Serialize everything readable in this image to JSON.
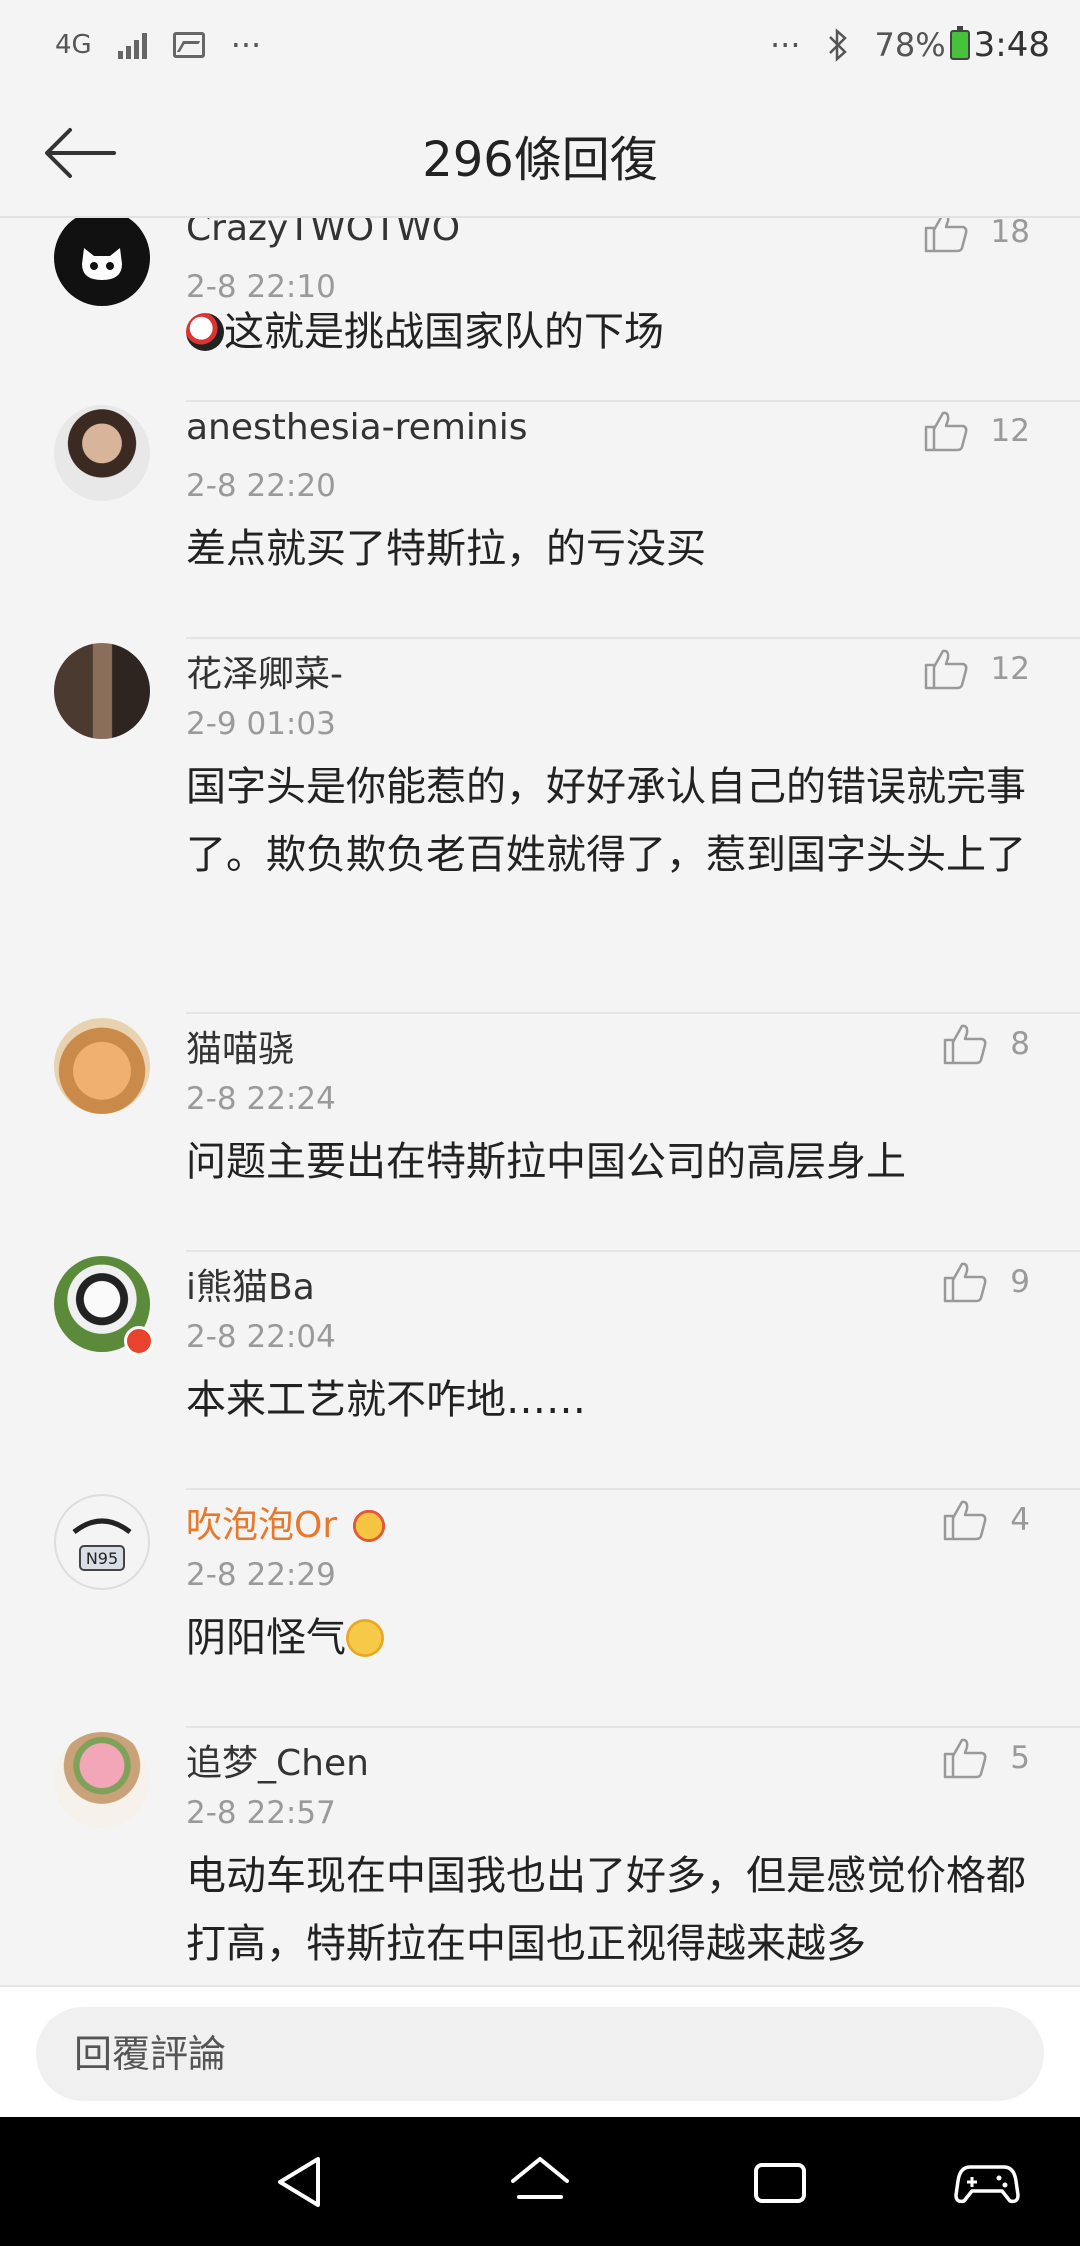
{
  "status": {
    "network": "4G",
    "battery": "78%",
    "time": "3:48",
    "more_left": "···",
    "more_right": "···",
    "icons": [
      "signal-icon",
      "image-icon",
      "bluetooth-icon",
      "battery-icon"
    ]
  },
  "header": {
    "title": "296條回復",
    "back_icon": "arrow-left-icon"
  },
  "comments": [
    {
      "user": "CrazyTWOTWO",
      "date": "2-8 22:10",
      "text": "这就是挑战国家队的下场",
      "likes": "18",
      "vip": false,
      "emoji_prefix": "panda-emoji"
    },
    {
      "user": "anesthesia-reminis",
      "date": "2-8 22:20",
      "text": "差点就买了特斯拉，的亏没买",
      "likes": "12",
      "vip": false
    },
    {
      "user": "花泽卿菜-",
      "date": "2-9 01:03",
      "text": "国字头是你能惹的，好好承认自己的错误就完事了。欺负欺负老百姓就得了，惹到国字头头上了",
      "likes": "12",
      "vip": false
    },
    {
      "user": "猫喵骁",
      "date": "2-8 22:24",
      "text": "问题主要出在特斯拉中国公司的高层身上",
      "likes": "8",
      "vip": false
    },
    {
      "user": "i熊猫Ba",
      "date": "2-8 22:04",
      "text": "本来工艺就不咋地……",
      "likes": "9",
      "vip": false
    },
    {
      "user": "吹泡泡Or",
      "date": "2-8 22:29",
      "text": "阴阳怪气",
      "likes": "4",
      "vip": true,
      "emoji_suffix": "sweat-emoji"
    },
    {
      "user": "追梦_Chen",
      "date": "2-8 22:57",
      "text": "电动车现在中国我也出了好多，但是感觉价格都打高，特斯拉在中国也正视得越来越多",
      "likes": "5",
      "vip": false
    }
  ],
  "reply": {
    "placeholder": "回覆評論"
  },
  "nav": {
    "icons": [
      "nav-back-icon",
      "nav-home-icon",
      "nav-recents-icon",
      "gamepad-icon"
    ]
  }
}
